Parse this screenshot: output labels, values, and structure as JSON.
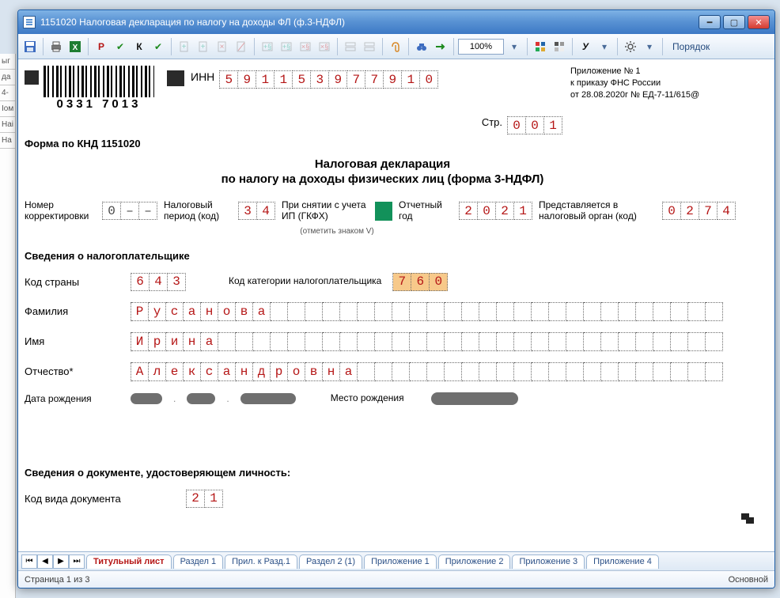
{
  "window": {
    "title": "1151020  Налоговая декларация по налогу на доходы ФЛ (ф.3-НДФЛ)"
  },
  "toolbar": {
    "zoom": "100%",
    "order": "Порядок"
  },
  "attachment": {
    "l1": "Приложение № 1",
    "l2": "к приказу ФНС России",
    "l3": "от 28.08.2020г № ЕД-7-11/615@"
  },
  "barcode_number": "0331 7013",
  "inn_label": "ИНН",
  "inn": [
    "5",
    "9",
    "1",
    "1",
    "5",
    "3",
    "9",
    "7",
    "7",
    "9",
    "1",
    "0"
  ],
  "page_label": "Стр.",
  "page_cells": [
    "0",
    "0",
    "1"
  ],
  "form_code": "Форма по КНД 1151020",
  "title1": "Налоговая декларация",
  "title2": "по налогу на доходы физических лиц (форма 3-НДФЛ)",
  "labels": {
    "corr_no": "Номер корректировки",
    "tax_period": "Налоговый период (код)",
    "dereg": "При снятии с учета ИП (ГКФХ)",
    "dereg_note": "(отметить знаком V)",
    "report_year": "Отчетный год",
    "authority": "Представляется в налоговый орган (код)",
    "taxpayer_section": "Сведения о налогоплательщике",
    "country_code": "Код страны",
    "category_code": "Код категории налогоплательщика",
    "surname": "Фамилия",
    "firstname": "Имя",
    "patronymic": "Отчество*",
    "dob": "Дата рождения",
    "pob": "Место рождения",
    "iddoc_section": "Сведения о документе, удостоверяющем личность:",
    "doc_type": "Код вида документа"
  },
  "fields": {
    "corr_no": [
      "0",
      "–",
      "–"
    ],
    "tax_period": [
      "3",
      "4"
    ],
    "report_year": [
      "2",
      "0",
      "2",
      "1"
    ],
    "authority": [
      "0",
      "2",
      "7",
      "4"
    ],
    "country_code": [
      "6",
      "4",
      "3"
    ],
    "category_code": [
      "7",
      "6",
      "0"
    ],
    "surname": [
      "Р",
      "у",
      "с",
      "а",
      "н",
      "о",
      "в",
      "а"
    ],
    "firstname": [
      "И",
      "р",
      "и",
      "н",
      "а"
    ],
    "patronymic": [
      "А",
      "л",
      "е",
      "к",
      "с",
      "а",
      "н",
      "д",
      "р",
      "о",
      "в",
      "н",
      "а"
    ],
    "doc_type": [
      "2",
      "1"
    ]
  },
  "tabs": {
    "items": [
      {
        "label": "Титульный лист",
        "active": true
      },
      {
        "label": "Раздел 1"
      },
      {
        "label": "Прил. к Разд.1"
      },
      {
        "label": "Раздел 2 (1)"
      },
      {
        "label": "Приложение 1"
      },
      {
        "label": "Приложение 2"
      },
      {
        "label": "Приложение 3"
      },
      {
        "label": "Приложение 4"
      }
    ]
  },
  "status": {
    "left": "Страница 1 из 3",
    "right": "Основной"
  },
  "cell_counts": {
    "surname": 34,
    "firstname": 34,
    "patronymic": 34
  }
}
